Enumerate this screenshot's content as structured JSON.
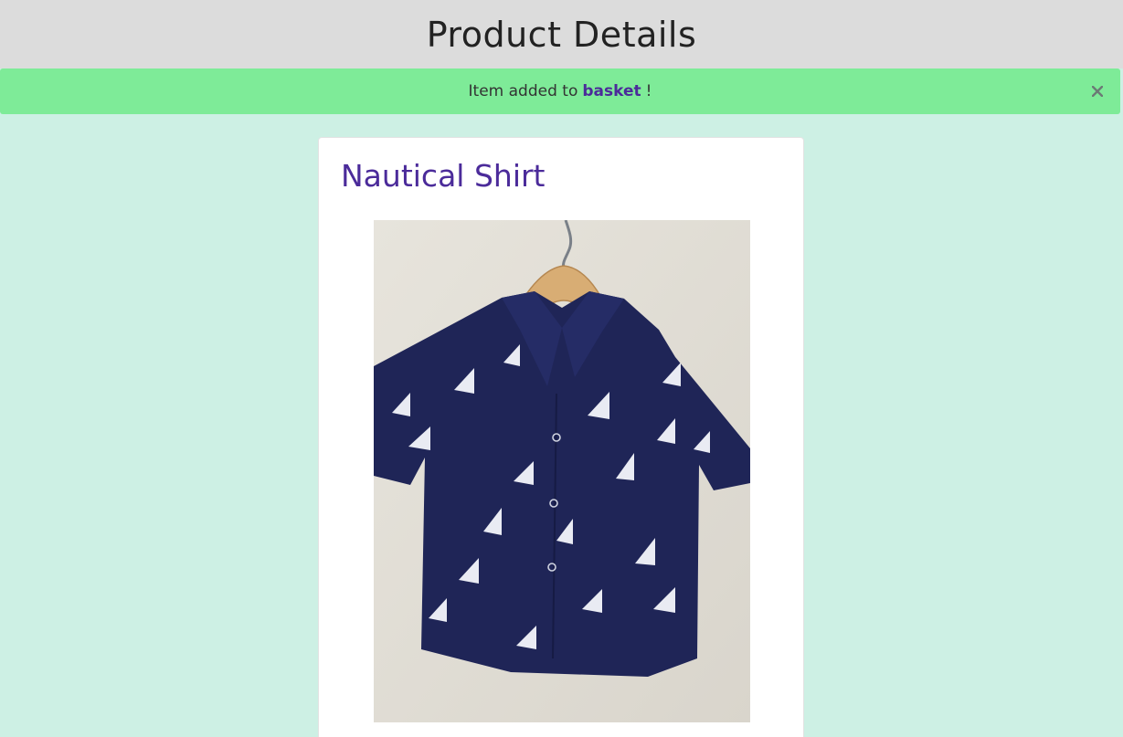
{
  "header": {
    "title": "Product Details"
  },
  "alert": {
    "prefix": "Item added to",
    "link_label": "basket",
    "suffix": "!",
    "close_icon": "close-icon",
    "background": "#7eeb98"
  },
  "product": {
    "name": "Nautical Shirt",
    "image_icon": "product-photo"
  },
  "colors": {
    "page_bg": "#cdf0e4",
    "header_bg": "#dcdcdc",
    "accent": "#4b2b9a",
    "shirt": "#1f2557"
  }
}
